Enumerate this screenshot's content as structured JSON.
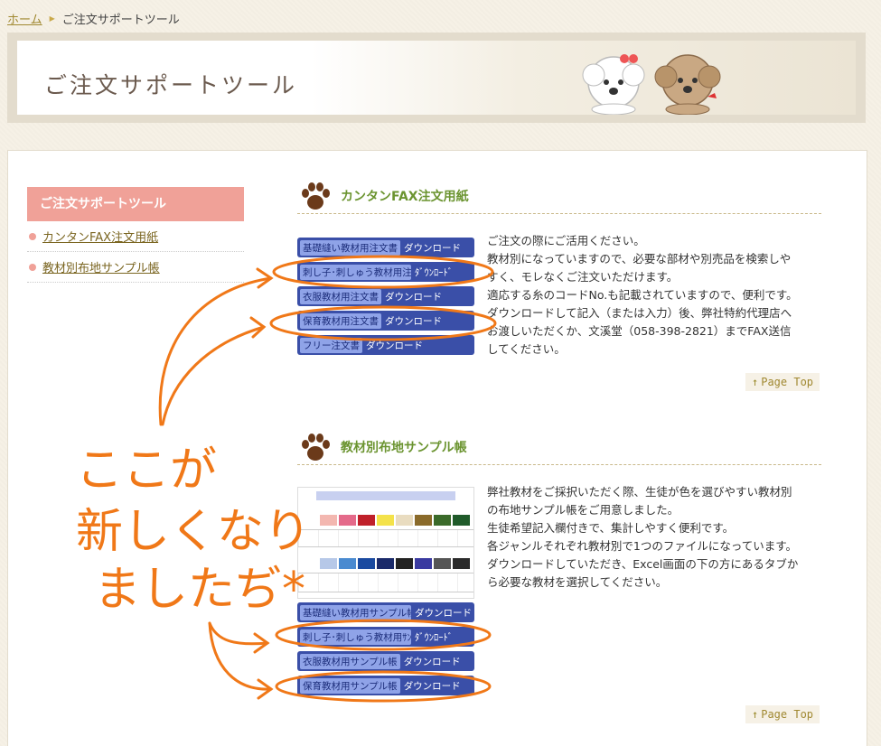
{
  "breadcrumb": {
    "home": "ホーム",
    "current": "ご注文サポートツール"
  },
  "banner": {
    "title": "ご注文サポートツール"
  },
  "sidebar": {
    "title": "ご注文サポートツール",
    "items": [
      {
        "label": "カンタンFAX注文用紙"
      },
      {
        "label": "教材別布地サンプル帳"
      }
    ]
  },
  "fax_section": {
    "title": "カンタンFAX注文用紙",
    "buttons": [
      {
        "label": "基礎縫い教材用注文書",
        "action": "ダウンロード"
      },
      {
        "label": "刺し子･刺しゅう教材用注文書",
        "action": "ﾀﾞｳﾝﾛｰﾄﾞ"
      },
      {
        "label": "衣服教材用注文書",
        "action": "ダウンロード"
      },
      {
        "label": "保育教材用注文書",
        "action": "ダウンロード"
      },
      {
        "label": "フリー注文書",
        "action": "ダウンロード"
      }
    ],
    "text": [
      "ご注文の際にご活用ください。",
      "教材別になっていますので、必要な部材や別売品を検索しや",
      "すく、モレなくご注文いただけます。",
      "適応する糸のコードNo.も記載されていますので、便利です。",
      "ダウンロードして記入（または入力）後、弊社特約代理店へ",
      "お渡しいただくか、文溪堂（058-398-2821）までFAX送信",
      "してください。"
    ]
  },
  "sample_section": {
    "title": "教材別布地サンプル帳",
    "buttons": [
      {
        "label": "基礎縫い教材用サンプル帳",
        "action": "ダウンロード"
      },
      {
        "label": "刺し子･刺しゅう教材用ｻﾝﾌﾟﾙ帳",
        "action": "ﾀﾞｳﾝﾛｰﾄﾞ"
      },
      {
        "label": "衣服教材用サンプル帳",
        "action": "ダウンロード"
      },
      {
        "label": "保育教材用サンプル帳",
        "action": "ダウンロード"
      }
    ],
    "text": [
      "弊社教材をご採択いただく際、生徒が色を選びやすい教材別",
      "の布地サンプル帳をご用意しました。",
      "生徒希望記入欄付きで、集計しやすく便利です。",
      "各ジャンルそれぞれ教材別で1つのファイルになっています。",
      "ダウンロードしていただき、Excel画面の下の方にあるタブか",
      "ら必要な教材を選択してください。"
    ],
    "swatches_row1": [
      "#f3b7b0",
      "#e46a8a",
      "#c0202a",
      "#f4e24a",
      "#e9dcc0",
      "#8a6a2a",
      "#3a6a2a",
      "#1f5a2a"
    ],
    "swatches_row2": [
      "#b6c8e8",
      "#4a8ad0",
      "#1a4aa0",
      "#1a2a6a",
      "#222",
      "#3a3aa0",
      "#555",
      "#2a2a2a"
    ]
  },
  "page_top": "Page Top",
  "annotation": {
    "lines": [
      "ここが",
      "新しくなり",
      "ましたぢ*"
    ],
    "color": "#f07818"
  }
}
